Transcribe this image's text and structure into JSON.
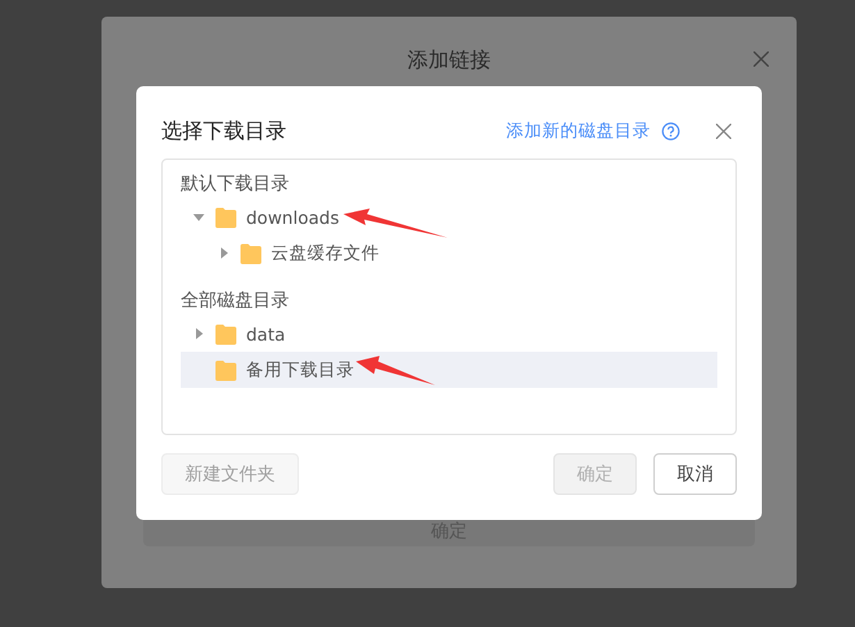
{
  "background_dialog": {
    "title": "添加链接",
    "confirm_button": "确定"
  },
  "dialog": {
    "title": "选择下载目录",
    "add_link": "添加新的磁盘目录",
    "sections": [
      {
        "label": "默认下载目录",
        "items": [
          {
            "name": "downloads",
            "expanded": true,
            "selected": false,
            "children": [
              {
                "name": "云盘缓存文件",
                "expanded": false,
                "selected": false
              }
            ]
          }
        ]
      },
      {
        "label": "全部磁盘目录",
        "items": [
          {
            "name": "data",
            "expanded": false,
            "selected": false
          },
          {
            "name": "备用下载目录",
            "selected": true
          }
        ]
      }
    ],
    "buttons": [
      {
        "label": "新建文件夹",
        "disabled": true,
        "kind": "left"
      },
      {
        "label": "确定",
        "disabled": true,
        "kind": "primary"
      },
      {
        "label": "取消",
        "disabled": false,
        "kind": "default"
      }
    ]
  }
}
